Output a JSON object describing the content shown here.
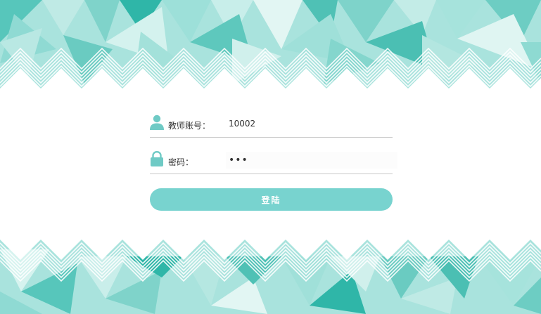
{
  "login_form": {
    "account_label": "教师账号：",
    "account_value": "10002",
    "password_label": "密码：",
    "password_value": "123",
    "submit_label": "登陆"
  },
  "icons": {
    "account": "user-icon",
    "password": "lock-icon"
  },
  "colors": {
    "accent": "#78d3cf",
    "icon": "#6fcac5",
    "banner_dark": "#2fb6a8",
    "banner_light": "#d8f3f0"
  }
}
